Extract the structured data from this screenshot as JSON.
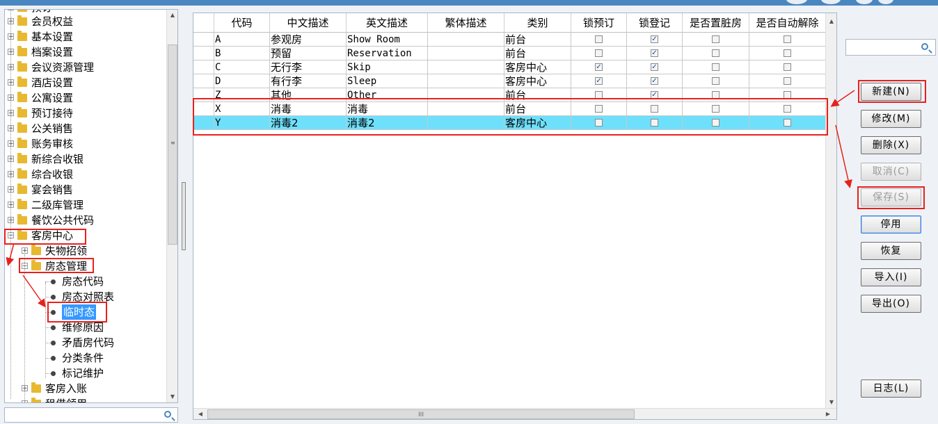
{
  "theme": {
    "accent": "#3399ff",
    "selected_row": "#6ee0fb",
    "annotation": "#e8201c",
    "folder": "#e8b830"
  },
  "tree": {
    "partial_top": "预订",
    "items": [
      {
        "label": "会员权益",
        "type": "folder",
        "expanded": false,
        "level": 0
      },
      {
        "label": "基本设置",
        "type": "folder",
        "expanded": false,
        "level": 0
      },
      {
        "label": "档案设置",
        "type": "folder",
        "expanded": false,
        "level": 0
      },
      {
        "label": "会议资源管理",
        "type": "folder",
        "expanded": false,
        "level": 0
      },
      {
        "label": "酒店设置",
        "type": "folder",
        "expanded": false,
        "level": 0
      },
      {
        "label": "公寓设置",
        "type": "folder",
        "expanded": false,
        "level": 0
      },
      {
        "label": "预订接待",
        "type": "folder",
        "expanded": false,
        "level": 0
      },
      {
        "label": "公关销售",
        "type": "folder",
        "expanded": false,
        "level": 0
      },
      {
        "label": "账务审核",
        "type": "folder",
        "expanded": false,
        "level": 0
      },
      {
        "label": "新综合收银",
        "type": "folder",
        "expanded": false,
        "level": 0
      },
      {
        "label": "综合收银",
        "type": "folder",
        "expanded": false,
        "level": 0
      },
      {
        "label": "宴会销售",
        "type": "folder",
        "expanded": false,
        "level": 0
      },
      {
        "label": "二级库管理",
        "type": "folder",
        "expanded": false,
        "level": 0
      },
      {
        "label": "餐饮公共代码",
        "type": "folder",
        "expanded": false,
        "level": 0
      },
      {
        "label": "客房中心",
        "type": "folder",
        "expanded": true,
        "level": 0
      },
      {
        "label": "失物招领",
        "type": "folder",
        "expanded": false,
        "level": 1
      },
      {
        "label": "房态管理",
        "type": "folder",
        "expanded": true,
        "level": 1
      },
      {
        "label": "房态代码",
        "type": "leaf",
        "level": 2
      },
      {
        "label": "房态对照表",
        "type": "leaf",
        "level": 2
      },
      {
        "label": "临时态",
        "type": "leaf",
        "level": 2,
        "selected": true
      },
      {
        "label": "维修原因",
        "type": "leaf",
        "level": 2
      },
      {
        "label": "矛盾房代码",
        "type": "leaf",
        "level": 2
      },
      {
        "label": "分类条件",
        "type": "leaf",
        "level": 2
      },
      {
        "label": "标记维护",
        "type": "leaf",
        "level": 2
      },
      {
        "label": "客房入账",
        "type": "folder",
        "expanded": false,
        "level": 1
      },
      {
        "label": "租借领用",
        "type": "folder",
        "expanded": false,
        "level": 1
      }
    ],
    "search_value": ""
  },
  "grid": {
    "columns": [
      "代码",
      "中文描述",
      "英文描述",
      "繁体描述",
      "类别",
      "锁预订",
      "锁登记",
      "是否置脏房",
      "是否自动解除"
    ],
    "rows": [
      {
        "code": "A",
        "cn": "参观房",
        "en": "Show Room",
        "tw": "",
        "category": "前台",
        "checks": [
          false,
          true,
          false,
          false
        ]
      },
      {
        "code": "B",
        "cn": "预留",
        "en": "Reservation",
        "tw": "",
        "category": "前台",
        "checks": [
          false,
          true,
          false,
          false
        ]
      },
      {
        "code": "C",
        "cn": "无行李",
        "en": "Skip",
        "tw": "",
        "category": "客房中心",
        "checks": [
          true,
          true,
          false,
          false
        ]
      },
      {
        "code": "D",
        "cn": "有行李",
        "en": "Sleep",
        "tw": "",
        "category": "客房中心",
        "checks": [
          true,
          true,
          false,
          false
        ]
      },
      {
        "code": "Z",
        "cn": "其他",
        "en": "Other",
        "tw": "",
        "category": "前台",
        "checks": [
          false,
          true,
          false,
          false
        ]
      },
      {
        "code": "X",
        "cn": "消毒",
        "en": "消毒",
        "tw": "",
        "category": "前台",
        "checks": [
          false,
          false,
          false,
          false
        ]
      },
      {
        "code": "Y",
        "cn": "消毒2",
        "en": "消毒2",
        "tw": "",
        "category": "客房中心",
        "checks": [
          false,
          false,
          false,
          false
        ],
        "selected": true
      }
    ]
  },
  "right_panel": {
    "search_value": "",
    "buttons": [
      {
        "id": "new",
        "label": "新建(N)",
        "enabled": true
      },
      {
        "id": "edit",
        "label": "修改(M)",
        "enabled": true
      },
      {
        "id": "delete",
        "label": "删除(X)",
        "enabled": true
      },
      {
        "id": "cancel",
        "label": "取消(C)",
        "enabled": false
      },
      {
        "id": "save",
        "label": "保存(S)",
        "enabled": false
      },
      {
        "id": "disable",
        "label": "停用",
        "enabled": true,
        "focused": true
      },
      {
        "id": "restore",
        "label": "恢复",
        "enabled": true
      },
      {
        "id": "import",
        "label": "导入(I)",
        "enabled": true
      },
      {
        "id": "export",
        "label": "导出(O)",
        "enabled": true
      },
      {
        "id": "log",
        "label": "日志(L)",
        "enabled": true
      }
    ]
  }
}
